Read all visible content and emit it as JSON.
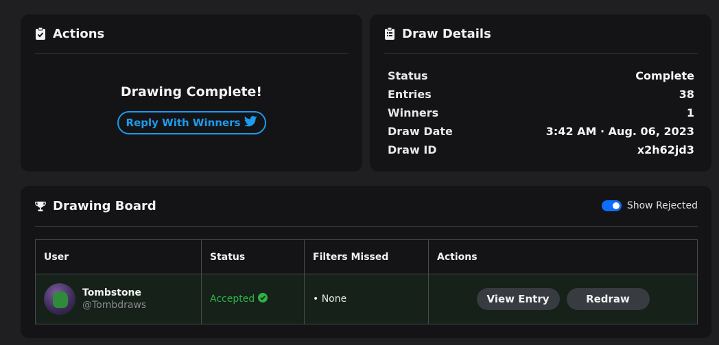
{
  "actions": {
    "title": "Actions",
    "complete_text": "Drawing Complete!",
    "reply_button": "Reply With Winners"
  },
  "details": {
    "title": "Draw Details",
    "rows": [
      {
        "label": "Status",
        "value": "Complete"
      },
      {
        "label": "Entries",
        "value": "38"
      },
      {
        "label": "Winners",
        "value": "1"
      },
      {
        "label": "Draw Date",
        "value": "3:42 AM · Aug. 06, 2023"
      },
      {
        "label": "Draw ID",
        "value": "x2h62jd3"
      }
    ]
  },
  "board": {
    "title": "Drawing Board",
    "toggle_label": "Show Rejected",
    "toggle_on": true,
    "columns": [
      "User",
      "Status",
      "Filters Missed",
      "Actions"
    ],
    "rows": [
      {
        "name": "Tombstone",
        "handle": "@Tombdraws",
        "status": "Accepted",
        "filters": "• None",
        "view_button": "View Entry",
        "redraw_button": "Redraw"
      }
    ]
  },
  "colors": {
    "background": "#1f1f22",
    "card": "#141416",
    "twitter_blue": "#1d9bf0",
    "accepted_green": "#2fb344",
    "toggle_blue": "#0d6efd"
  },
  "icons": {
    "actions": "clipboard-check-icon",
    "details": "clipboard-list-icon",
    "board": "trophy-icon",
    "reply": "twitter-icon",
    "accepted": "check-circle-icon"
  }
}
